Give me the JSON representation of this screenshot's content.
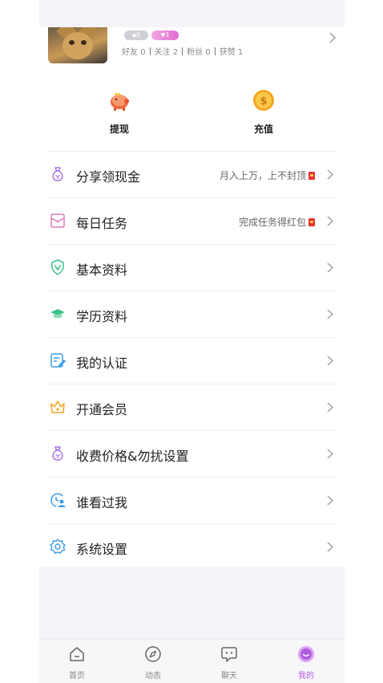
{
  "profile": {
    "badges": [
      "0",
      "1"
    ],
    "stats": [
      {
        "label": "好友",
        "value": "0"
      },
      {
        "label": "关注",
        "value": "2"
      },
      {
        "label": "粉丝",
        "value": "0"
      },
      {
        "label": "获赞",
        "value": "1"
      }
    ]
  },
  "quick_actions": {
    "withdraw": "提现",
    "recharge": "充值"
  },
  "menu": [
    {
      "label": "分享领现金",
      "desc": "月入上万，上不封顶",
      "icon": "money-bag-icon"
    },
    {
      "label": "每日任务",
      "desc": "完成任务得红包",
      "icon": "envelope-icon"
    },
    {
      "label": "基本资料",
      "desc": "",
      "icon": "shield-v-icon"
    },
    {
      "label": "学历资料",
      "desc": "",
      "icon": "graduation-cap-icon"
    },
    {
      "label": "我的认证",
      "desc": "",
      "icon": "certificate-edit-icon"
    },
    {
      "label": "开通会员",
      "desc": "",
      "icon": "crown-icon"
    },
    {
      "label": "收费价格&勿扰设置",
      "desc": "",
      "icon": "money-bag-icon"
    },
    {
      "label": "谁看过我",
      "desc": "",
      "icon": "visitor-icon"
    },
    {
      "label": "系统设置",
      "desc": "",
      "icon": "gear-icon"
    }
  ],
  "tabs": [
    {
      "label": "首页",
      "active": false
    },
    {
      "label": "动态",
      "active": false
    },
    {
      "label": "聊天",
      "active": false
    },
    {
      "label": "我的",
      "active": true
    }
  ],
  "colors": {
    "accent": "#b05be0",
    "menu_icon": "#a872e6",
    "red_packet": "#e8332f"
  }
}
